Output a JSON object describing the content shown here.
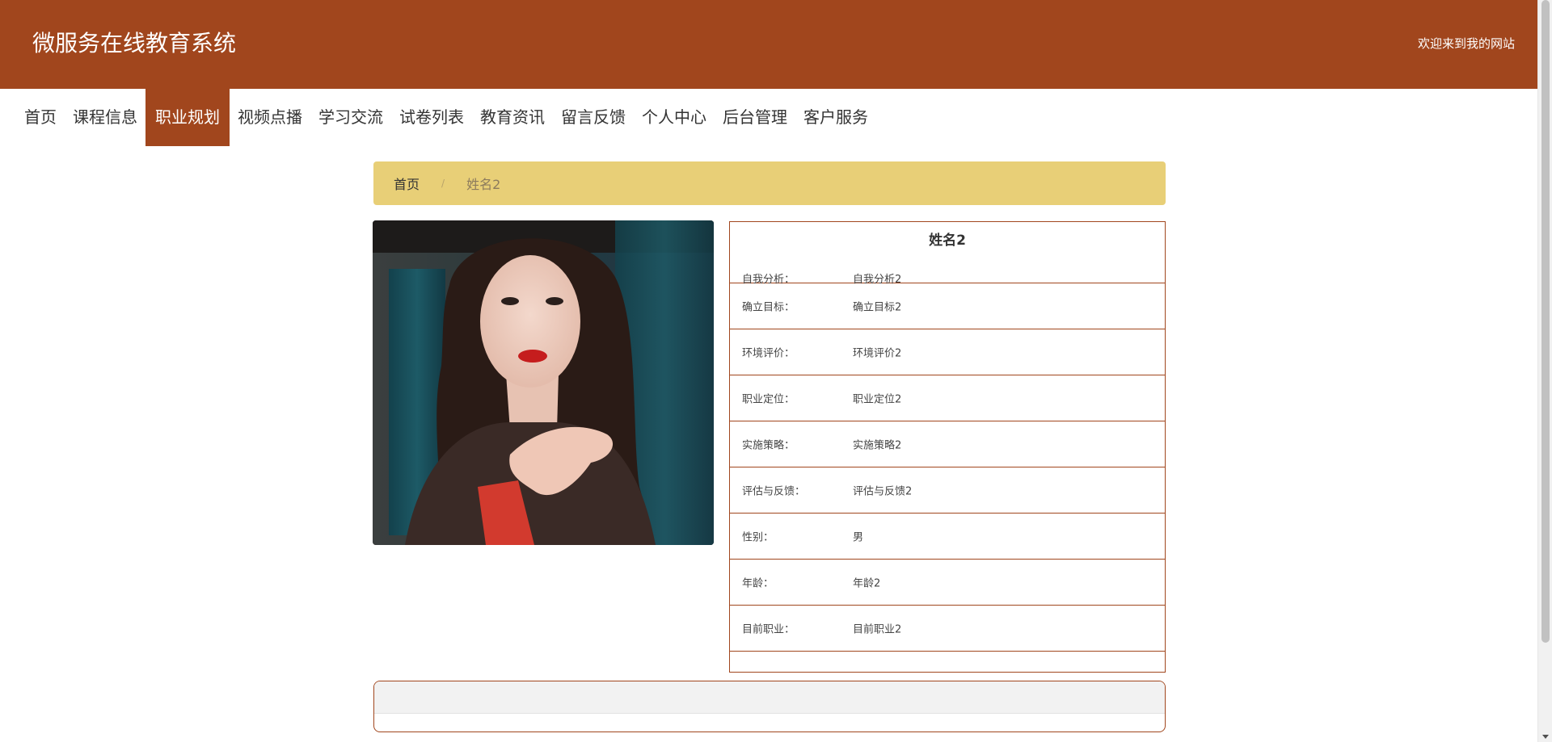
{
  "header": {
    "site_title": "微服务在线教育系统",
    "welcome": "欢迎来到我的网站"
  },
  "nav": {
    "items": [
      {
        "label": "首页"
      },
      {
        "label": "课程信息"
      },
      {
        "label": "职业规划"
      },
      {
        "label": "视频点播"
      },
      {
        "label": "学习交流"
      },
      {
        "label": "试卷列表"
      },
      {
        "label": "教育资讯"
      },
      {
        "label": "留言反馈"
      },
      {
        "label": "个人中心"
      },
      {
        "label": "后台管理"
      },
      {
        "label": "客户服务"
      }
    ],
    "active_label": "职业规划"
  },
  "breadcrumb": {
    "home": "首页",
    "separator": "/",
    "current": "姓名2"
  },
  "detail": {
    "title": "姓名2",
    "rows": [
      {
        "label": "自我分析：",
        "value": "自我分析2"
      },
      {
        "label": "确立目标：",
        "value": "确立目标2"
      },
      {
        "label": "环境评价：",
        "value": "环境评价2"
      },
      {
        "label": "职业定位：",
        "value": "职业定位2"
      },
      {
        "label": "实施策略：",
        "value": "实施策略2"
      },
      {
        "label": "评估与反馈：",
        "value": "评估与反馈2"
      },
      {
        "label": "性别：",
        "value": "男"
      },
      {
        "label": "年龄：",
        "value": "年龄2"
      },
      {
        "label": "目前职业：",
        "value": "目前职业2"
      }
    ]
  },
  "colors": {
    "primary": "#a1461d",
    "breadcrumb_bg": "#e8cf77",
    "panel_grey": "#f2f2f2"
  },
  "icons": {
    "profile_photo": "portrait-photo",
    "scroll_down": "chevron-down-icon"
  }
}
